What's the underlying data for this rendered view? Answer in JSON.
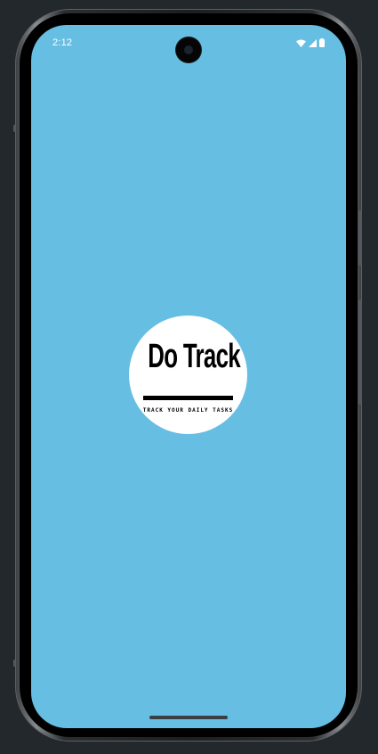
{
  "status_bar": {
    "time": "2:12",
    "icons": [
      "wifi-icon",
      "cellular-signal-icon",
      "battery-icon"
    ]
  },
  "splash": {
    "background_color": "#67bee3",
    "logo": {
      "title": "Do Track",
      "tagline": "TRACK YOUR DAILY TASKS"
    }
  },
  "navigation": {
    "gesture_bar": "home-indicator"
  }
}
